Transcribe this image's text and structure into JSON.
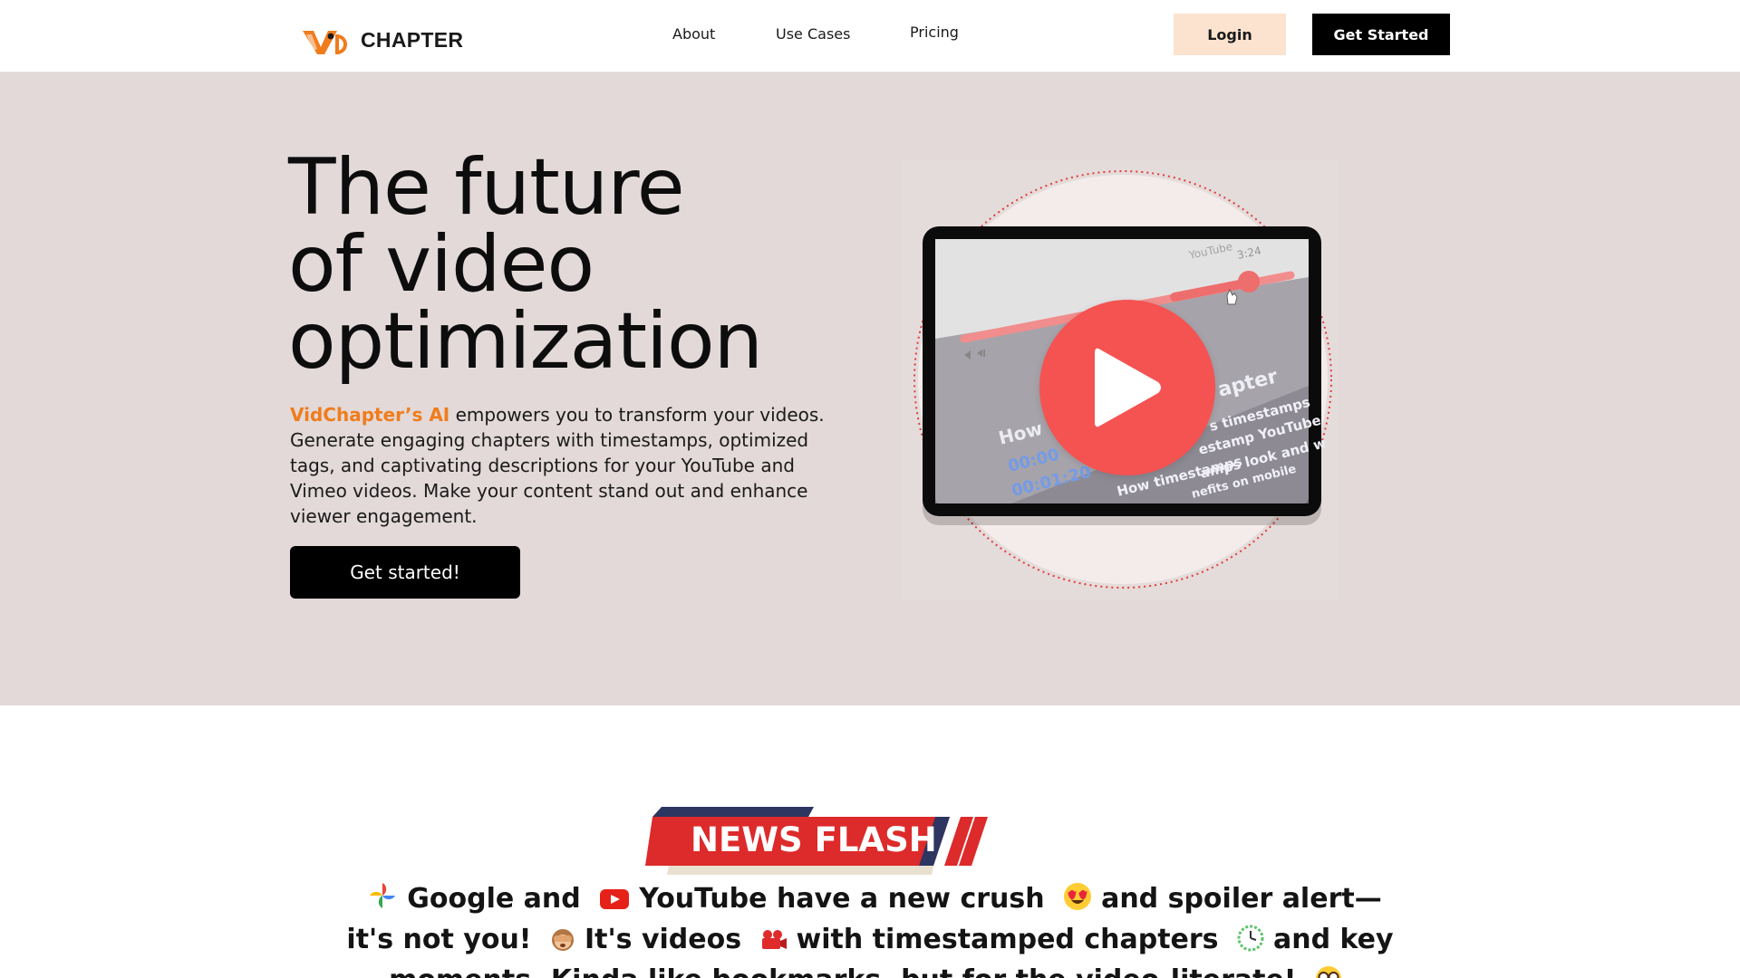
{
  "header": {
    "logo_text": "CHAPTER",
    "nav": [
      "About",
      "Use Cases",
      "Pricing"
    ],
    "login_label": "Login",
    "get_started_label": "Get Started"
  },
  "hero": {
    "title_lines": [
      "The future",
      "of video",
      "optimization"
    ],
    "brand_name": "VidChapter’s AI",
    "description": " empowers you to transform your videos. Generate engaging chapters with timestamps, optimized tags, and captivating descriptions for your YouTube and Vimeo videos. Make your content stand out and enhance viewer engagement.",
    "cta_label": "Get started!",
    "video_overlay": {
      "platform_label": "YouTube",
      "time_label": "3:24",
      "word_how": "How",
      "timestamps": [
        "00:00",
        "00:01:20"
      ],
      "word_apter": "apter",
      "lines": [
        "s timestamps",
        "estamp YouTube",
        "amps look and w",
        "How timestamps",
        "nefits on mobile"
      ]
    }
  },
  "news": {
    "banner_label": "NEWS FLASH",
    "segments": [
      "Google and",
      "YouTube",
      "have a new crush",
      "and spoiler alert—it's not you!",
      "It's videos",
      "with timestamped chapters",
      "and key moments. Kinda like bookmarks, but for the video-literate!"
    ]
  },
  "colors": {
    "hero_bg": "#e2d9d8",
    "brand_orange": "#f07c1c",
    "login_bg": "#fbe3cf",
    "play_red": "#f55252",
    "banner_red": "#dd2a2a",
    "banner_navy": "#2d3561"
  }
}
